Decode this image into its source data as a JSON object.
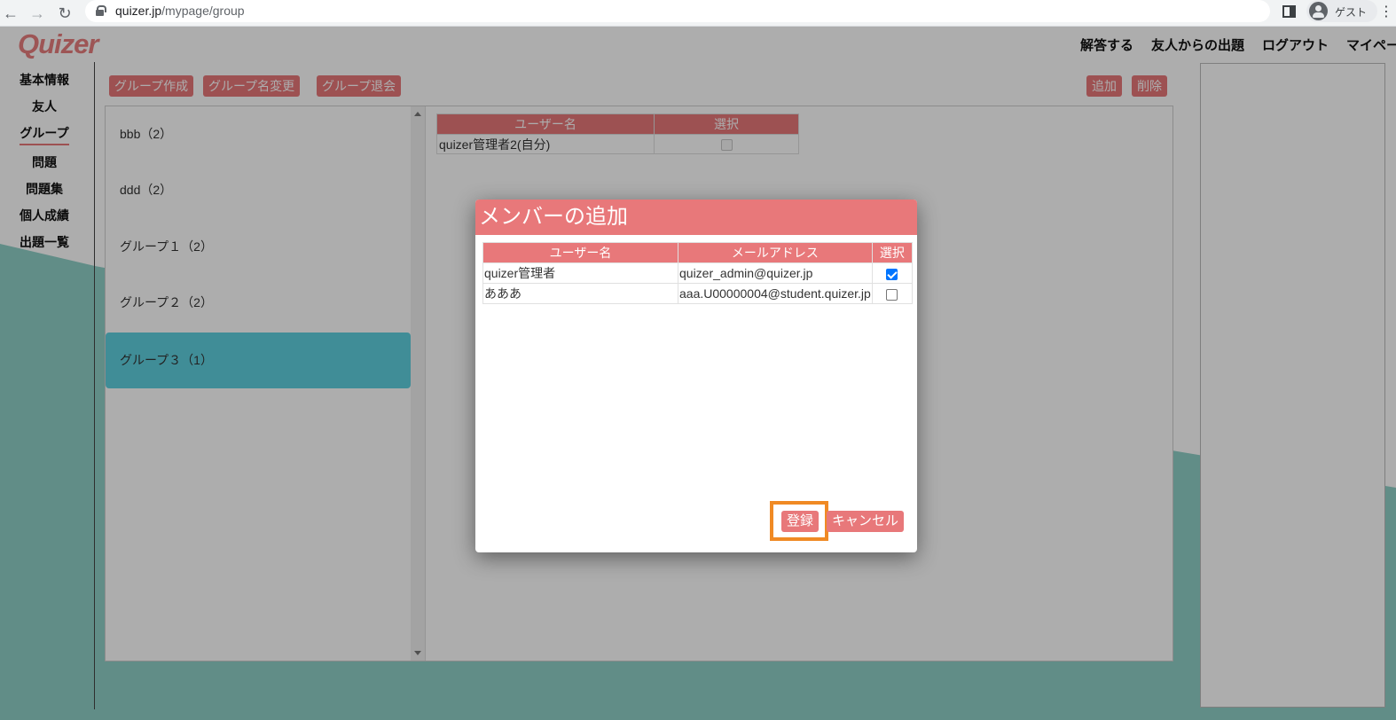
{
  "browser": {
    "url_host": "quizer.jp",
    "url_path": "/mypage/group",
    "profile_label": "ゲスト"
  },
  "app": {
    "logo": "Quizer",
    "top_nav": [
      "解答する",
      "友人からの出題",
      "ログアウト",
      "マイページ"
    ]
  },
  "sidebar": {
    "items": [
      "基本情報",
      "友人",
      "グループ",
      "問題",
      "問題集",
      "個人成績",
      "出題一覧"
    ],
    "active": "グループ"
  },
  "toolbar": {
    "create_group": "グループ作成",
    "rename_group": "グループ名変更",
    "leave_group": "グループ退会",
    "add": "追加",
    "delete": "削除"
  },
  "groups": [
    {
      "label": "bbb（2）",
      "selected": false
    },
    {
      "label": "ddd（2）",
      "selected": false
    },
    {
      "label": "グループ１（2）",
      "selected": false
    },
    {
      "label": "グループ２（2）",
      "selected": false
    },
    {
      "label": "グループ３（1）",
      "selected": true
    }
  ],
  "members_table": {
    "headers": [
      "ユーザー名",
      "選択"
    ],
    "rows": [
      {
        "username": "quizer管理者2(自分)",
        "selectable": false
      }
    ]
  },
  "modal": {
    "title": "メンバーの追加",
    "headers": [
      "ユーザー名",
      "メールアドレス",
      "選択"
    ],
    "rows": [
      {
        "username": "quizer管理者",
        "email": "quizer_admin@quizer.jp",
        "checked": true
      },
      {
        "username": "あああ",
        "email": "aaa.U00000004@student.quizer.jp",
        "checked": false
      }
    ],
    "register_label": "登録",
    "cancel_label": "キャンセル"
  },
  "colors": {
    "accent": "#e8787a",
    "teal": "#8fd0c8",
    "selected_group": "#5fd0df",
    "highlight": "#f08a24"
  }
}
